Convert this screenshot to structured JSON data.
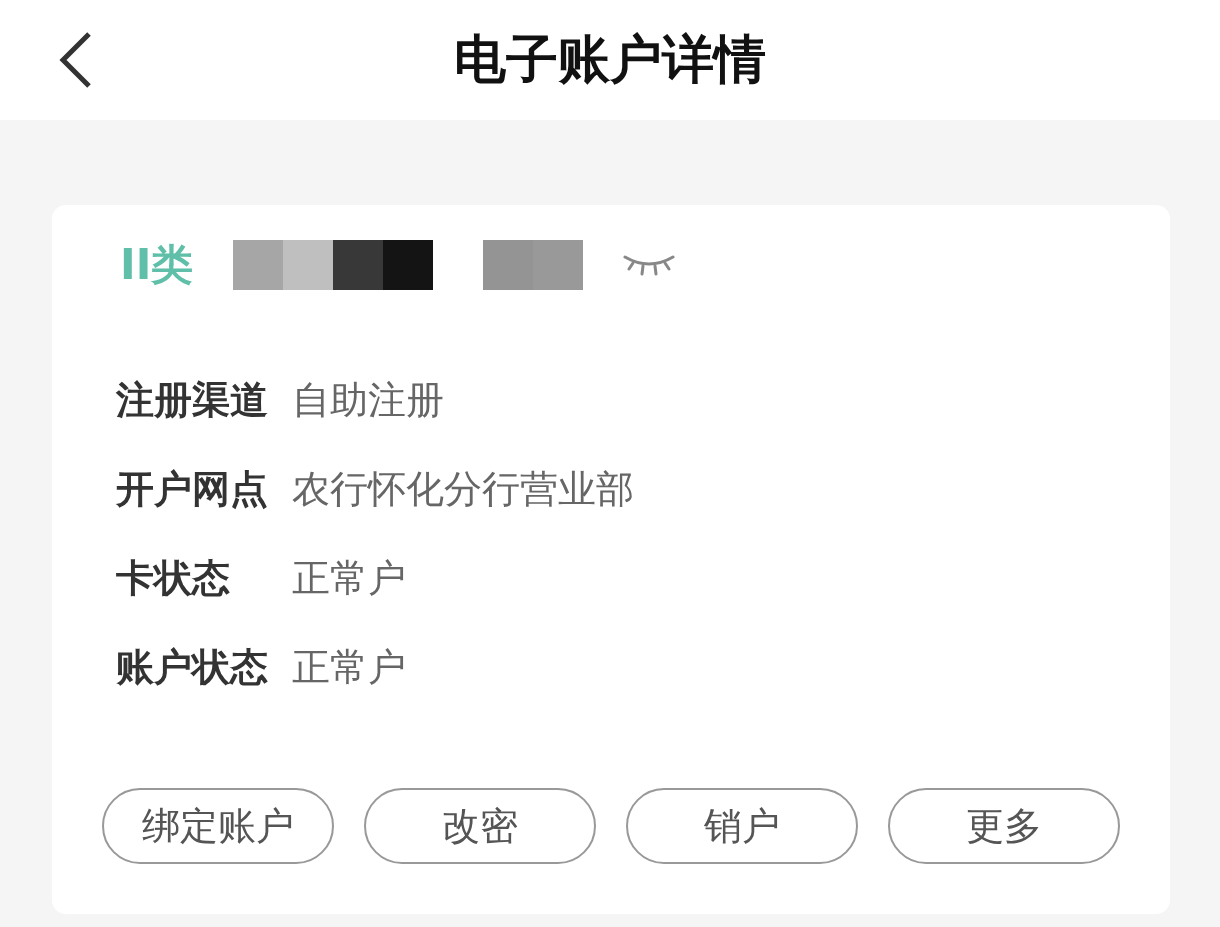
{
  "header": {
    "title": "电子账户详情"
  },
  "card": {
    "account_type": "II类",
    "details": [
      {
        "label": "注册渠道",
        "value": "自助注册"
      },
      {
        "label": "开户网点",
        "value": "农行怀化分行营业部"
      },
      {
        "label": "卡状态",
        "value": "正常户"
      },
      {
        "label": "账户状态",
        "value": "正常户"
      }
    ],
    "buttons": [
      "绑定账户",
      "改密",
      "销户",
      "更多"
    ]
  }
}
